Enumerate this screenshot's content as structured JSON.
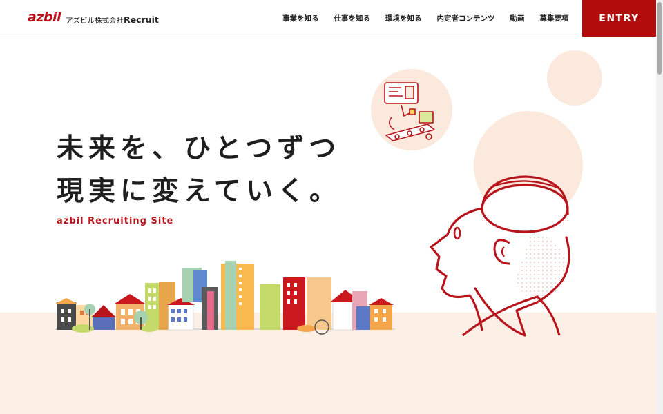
{
  "header": {
    "logo_mark": "azbil",
    "logo_company": "アズビル株式会社",
    "logo_recruit": "Recruit",
    "nav": [
      {
        "label": "事業を知る"
      },
      {
        "label": "仕事を知る"
      },
      {
        "label": "環境を知る"
      },
      {
        "label": "内定者コンテンツ"
      },
      {
        "label": "動画"
      },
      {
        "label": "募集要項"
      }
    ],
    "entry_label": "ENTRY"
  },
  "hero": {
    "headline_line1": "未来を、ひとつずつ",
    "headline_line2": "現実に変えていく。",
    "subtitle": "azbil Recruiting Site"
  },
  "colors": {
    "brand_red": "#b8141b",
    "entry_bg": "#b20d0d",
    "peach_bg": "#fcefe6",
    "circle": "#fce9de"
  }
}
